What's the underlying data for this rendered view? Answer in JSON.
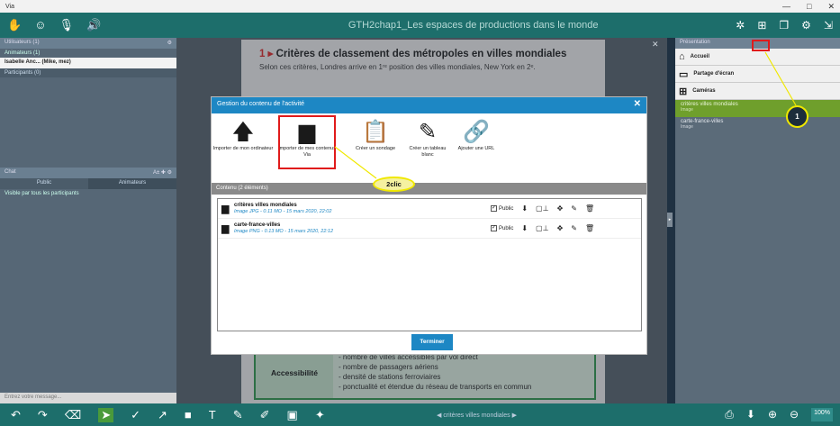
{
  "os": {
    "app_name": "Via",
    "min": "—",
    "max": "□",
    "close": "✕"
  },
  "toolbar": {
    "title": "GTH2chap1_Les espaces de productions dans le monde"
  },
  "left_panel": {
    "users_header": "Utilisateurs (1)",
    "animators": "Animateurs (1)",
    "user_name": "Isabelle Anc... (Mike, mez)",
    "participants": "Participants (0)",
    "chat_header": "Chat",
    "tab_public": "Public",
    "tab_animators": "Animateurs",
    "chat_visibility": "Visible par tous les participants",
    "chat_placeholder": "Entrez votre message..."
  },
  "slide": {
    "num": "1 ▸",
    "title": "Critères de classement des métropoles en villes mondiales",
    "subtitle": "Selon ces critères, Londres arrive en 1ʳᵉ position des villes mondiales, New York en 2ᵉ.",
    "acc_label": "Accessibilité",
    "acc_items": [
      "- nombre de villes accessibles par vol direct",
      "- nombre de passagers aériens",
      "- densité de stations ferroviaires",
      "- ponctualité et étendue du réseau de transports en commun"
    ]
  },
  "right_panel": {
    "header": "Présentation",
    "accueil": "Accueil",
    "partage": "Partage d'écran",
    "cameras": "Caméras",
    "file1": "critères villes mondiales",
    "file1_type": "Image",
    "file2": "carte-france-villes",
    "file2_type": "Image"
  },
  "modal": {
    "title": "Gestion du contenu de l'activité",
    "close": "✕",
    "tools": [
      {
        "label": "Importer de mon ordinateur",
        "icon": "upload-arrow-icon"
      },
      {
        "label": "Importer de mes contenus Via",
        "icon": "folder-icon"
      },
      {
        "label": "Créer un sondage",
        "icon": "survey-clipboard-icon"
      },
      {
        "label": "Créer un tableau blanc",
        "icon": "whiteboard-icon"
      },
      {
        "label": "Ajouter une URL",
        "icon": "link-icon"
      }
    ],
    "content_header": "Contenu (2 éléments)",
    "items": [
      {
        "name": "critères villes mondiales",
        "meta": "Image JPG - 0.11 MO - 15 mars 2020, 22:02",
        "public": "Public"
      },
      {
        "name": "carte-france-villes",
        "meta": "Image PNG - 0.13 MO - 15 mars 2020, 22:12",
        "public": "Public"
      }
    ],
    "finish": "Terminer"
  },
  "annotations": {
    "callout1": "1",
    "clic2": "2clic"
  },
  "bottom": {
    "page_label": "critères villes mondiales",
    "zoom": "100%"
  }
}
